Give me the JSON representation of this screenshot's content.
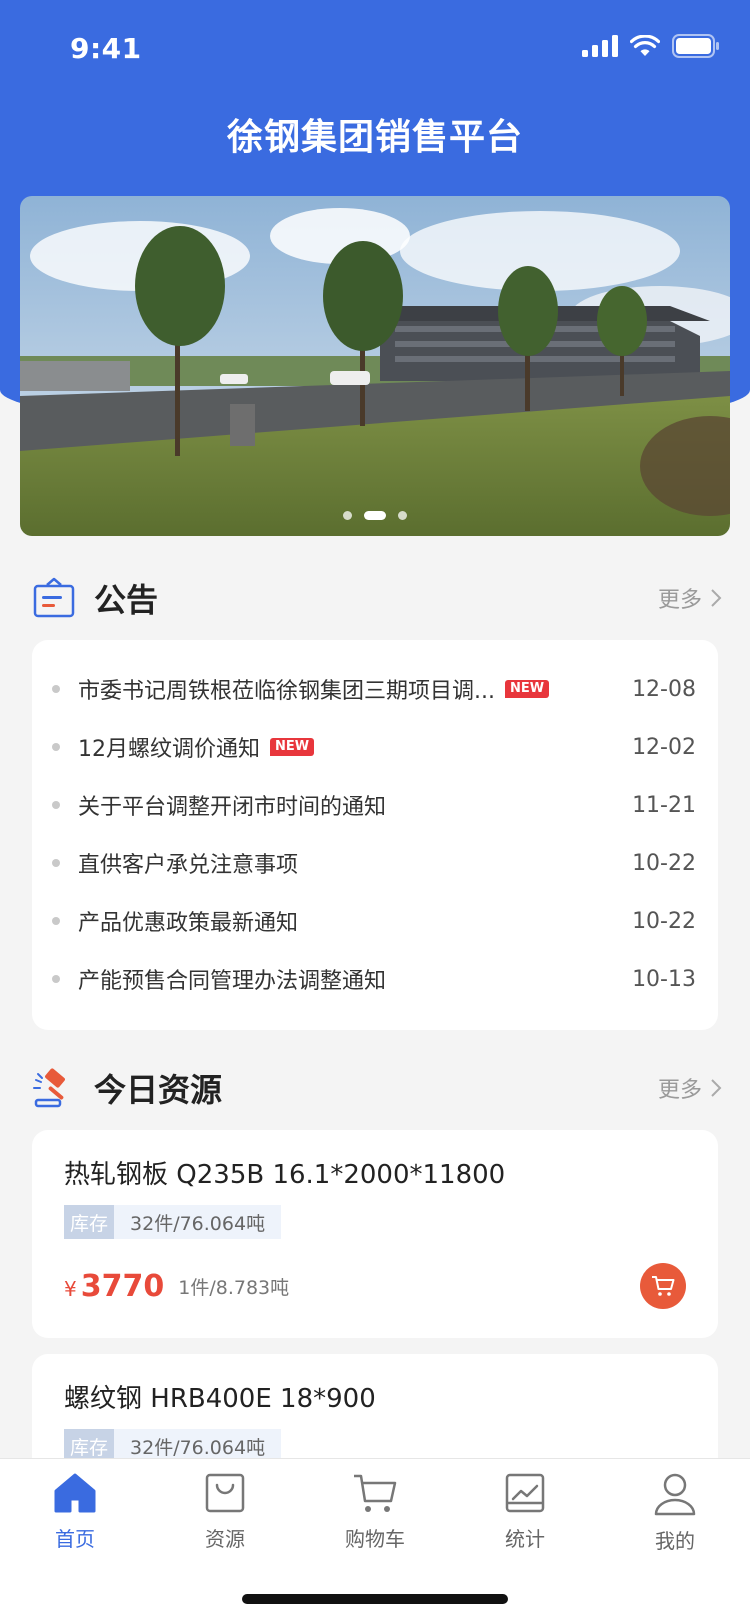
{
  "status": {
    "time": "9:41"
  },
  "app": {
    "title": "徐钢集团销售平台"
  },
  "banner": {
    "dots": 3,
    "active_dot": 1
  },
  "notice": {
    "title": "公告",
    "more": "更多",
    "items": [
      {
        "text": "市委书记周铁根莅临徐钢集团三期项目调...",
        "new": true,
        "date": "12-08"
      },
      {
        "text": "12月螺纹调价通知",
        "new": true,
        "date": "12-02"
      },
      {
        "text": "关于平台调整开闭市时间的通知",
        "new": false,
        "date": "11-21"
      },
      {
        "text": "直供客户承兑注意事项",
        "new": false,
        "date": "10-22"
      },
      {
        "text": "产品优惠政策最新通知",
        "new": false,
        "date": "10-22"
      },
      {
        "text": "产能预售合同管理办法调整通知",
        "new": false,
        "date": "10-13"
      }
    ],
    "new_label": "NEW"
  },
  "resources": {
    "title": "今日资源",
    "more": "更多",
    "stock_label": "库存",
    "items": [
      {
        "name": "热轧钢板 Q235B 16.1*2000*11800",
        "stock": "32件/76.064吨",
        "currency": "¥",
        "price": "3770",
        "unit": "1件/8.783吨"
      },
      {
        "name": "螺纹钢 HRB400E 18*900",
        "stock": "32件/76.064吨"
      }
    ]
  },
  "tabbar": {
    "items": [
      {
        "label": "首页",
        "icon": "home-icon",
        "active": true
      },
      {
        "label": "资源",
        "icon": "bag-icon",
        "active": false
      },
      {
        "label": "购物车",
        "icon": "cart-icon",
        "active": false
      },
      {
        "label": "统计",
        "icon": "chart-icon",
        "active": false
      },
      {
        "label": "我的",
        "icon": "user-icon",
        "active": false
      }
    ]
  },
  "colors": {
    "primary": "#3a6be0",
    "price": "#e84a3a",
    "badge": "#e8363c"
  }
}
